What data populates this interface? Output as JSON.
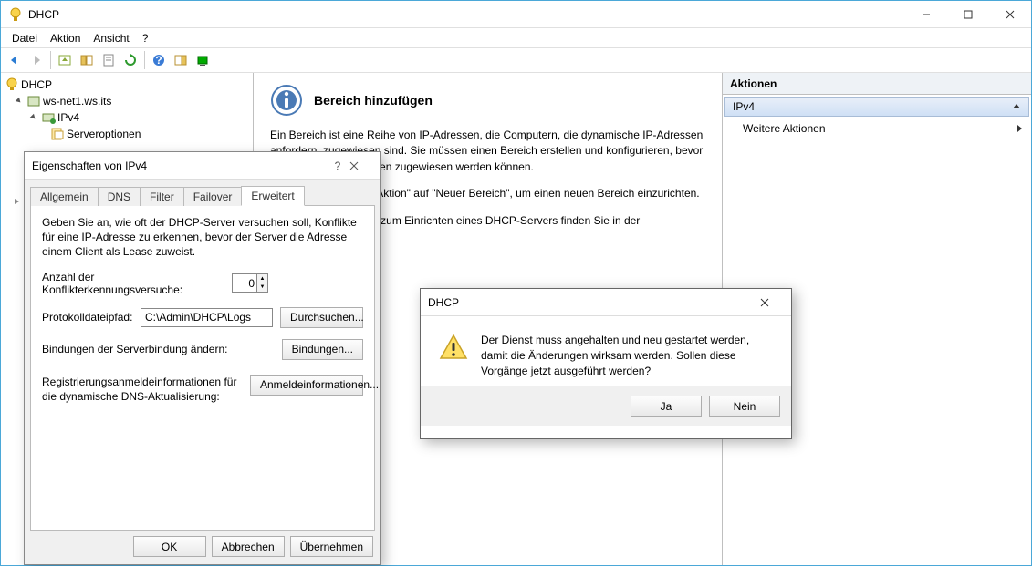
{
  "window": {
    "title": "DHCP",
    "menus": [
      "Datei",
      "Aktion",
      "Ansicht",
      "?"
    ]
  },
  "tree": {
    "root": "DHCP",
    "server": "ws-net1.ws.its",
    "scope": "IPv4",
    "sub": "Serveroptionen"
  },
  "detail": {
    "heading": "Bereich hinzufügen",
    "p1": "Ein Bereich ist eine Reihe von IP-Adressen, die Computern, die dynamische IP-Adressen anfordern, zugewiesen sind. Sie müssen einen Bereich erstellen und konfigurieren, bevor dynamische IP-Adressen zugewiesen werden können.",
    "p2": "Klicken Sie im Menü \"Aktion\" auf \"Neuer Bereich\", um einen neuen Bereich einzurichten.",
    "p3": "Weitere Informationen zum Einrichten eines DHCP-Servers finden Sie in der"
  },
  "actions": {
    "header": "Aktionen",
    "sub_header": "IPv4",
    "item1": "Weitere Aktionen"
  },
  "props": {
    "title": "Eigenschaften von IPv4",
    "tabs": [
      "Allgemein",
      "DNS",
      "Filter",
      "Failover",
      "Erweitert"
    ],
    "active_tab": 4,
    "intro": "Geben Sie an, wie oft der DHCP-Server versuchen soll, Konflikte für eine IP-Adresse zu erkennen, bevor der Server die Adresse einem Client als Lease zuweist.",
    "conflict_label": "Anzahl der Konflikterkennungsversuche:",
    "conflict_value": "0",
    "logpath_label": "Protokolldateipfad:",
    "logpath_value": "C:\\Admin\\DHCP\\Logs",
    "browse_btn": "Durchsuchen...",
    "bindings_label": "Bindungen der Serverbindung ändern:",
    "bindings_btn": "Bindungen...",
    "creds_label": "Registrierungsanmeldeinformationen für die dynamische DNS-Aktualisierung:",
    "creds_btn": "Anmeldeinformationen...",
    "ok": "OK",
    "cancel": "Abbrechen",
    "apply": "Übernehmen"
  },
  "msgbox": {
    "title": "DHCP",
    "text": "Der Dienst muss angehalten und neu gestartet werden, damit die Änderungen wirksam werden. Sollen diese Vorgänge jetzt ausgeführt werden?",
    "yes": "Ja",
    "no": "Nein"
  }
}
